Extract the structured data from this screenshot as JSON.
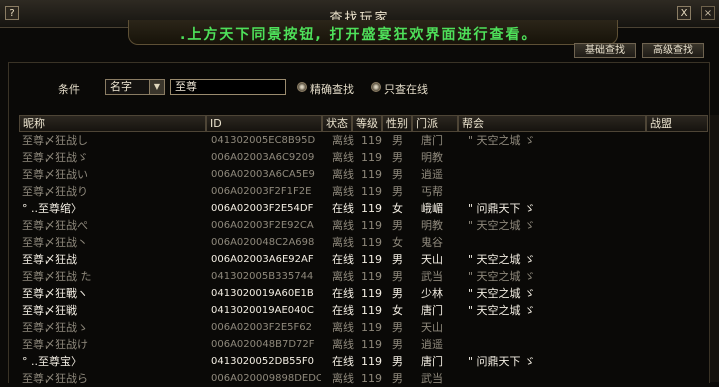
{
  "window": {
    "title": "查找玩家",
    "help": "?",
    "close": "X",
    "system_close": "×"
  },
  "banner": {
    "text": ".上方天下同景按钮, 打开盛宴狂欢界面进行查看。"
  },
  "top_buttons": {
    "basic": "基础查找",
    "advanced": "高级查找"
  },
  "search": {
    "condition_label": "条件",
    "field": "名字",
    "keyword": "至尊",
    "exact_label": "精确查找",
    "online_only_label": "只查在线"
  },
  "columns": [
    "昵称",
    "ID",
    "状态",
    "等级",
    "性别",
    "门派",
    "帮会",
    "战盟"
  ],
  "rows": [
    {
      "name": "至尊〆狂战し",
      "id": "041302005EC8B95D",
      "status": "离线",
      "level": "119",
      "gender": "男",
      "sect": "唐门",
      "guild": "\" 天空之城 ゞ",
      "alliance": "",
      "online": false
    },
    {
      "name": "至尊〆狂战ゞ",
      "id": "006A02003A6C9209",
      "status": "离线",
      "level": "119",
      "gender": "男",
      "sect": "明教",
      "guild": "",
      "alliance": "",
      "online": false
    },
    {
      "name": "至尊〆狂战い",
      "id": "006A02003A6CA5E9",
      "status": "离线",
      "level": "119",
      "gender": "男",
      "sect": "逍遥",
      "guild": "",
      "alliance": "",
      "online": false
    },
    {
      "name": "至尊〆狂战り",
      "id": "006A02003F2F1F2E",
      "status": "离线",
      "level": "119",
      "gender": "男",
      "sect": "丐帮",
      "guild": "",
      "alliance": "",
      "online": false
    },
    {
      "name": "° ..至尊绾〉",
      "id": "006A02003F2E54DF",
      "status": "在线",
      "level": "119",
      "gender": "女",
      "sect": "峨嵋",
      "guild": "\" 问鼎天下 ゞ",
      "alliance": "",
      "online": true
    },
    {
      "name": "至尊〆狂战ぺ",
      "id": "006A02003F2E92CA",
      "status": "离线",
      "level": "119",
      "gender": "男",
      "sect": "明教",
      "guild": "\" 天空之城 ゞ",
      "alliance": "",
      "online": false
    },
    {
      "name": "至尊〆狂战丶",
      "id": "006A020048C2A698",
      "status": "离线",
      "level": "119",
      "gender": "女",
      "sect": "鬼谷",
      "guild": "",
      "alliance": "",
      "online": false
    },
    {
      "name": "至尊〆狂战",
      "id": "006A02003A6E92AF",
      "status": "在线",
      "level": "119",
      "gender": "男",
      "sect": "天山",
      "guild": "\" 天空之城 ゞ",
      "alliance": "",
      "online": true
    },
    {
      "name": "至尊〆狂战 た",
      "id": "041302005B335744",
      "status": "离线",
      "level": "119",
      "gender": "男",
      "sect": "武当",
      "guild": "\" 天空之城 ゞ",
      "alliance": "",
      "online": false
    },
    {
      "name": "至尊〆狂戰ヽ",
      "id": "0413020019A60E1B",
      "status": "在线",
      "level": "119",
      "gender": "男",
      "sect": "少林",
      "guild": "\" 天空之城 ゞ",
      "alliance": "",
      "online": true
    },
    {
      "name": "至尊〆狂戦",
      "id": "0413020019AE040C",
      "status": "在线",
      "level": "119",
      "gender": "女",
      "sect": "唐门",
      "guild": "\" 天空之城 ゞ",
      "alliance": "",
      "online": true
    },
    {
      "name": "至尊〆狂战ゝ",
      "id": "006A02003F2E5F62",
      "status": "离线",
      "level": "119",
      "gender": "男",
      "sect": "天山",
      "guild": "",
      "alliance": "",
      "online": false
    },
    {
      "name": "至尊〆狂战け",
      "id": "006A020048B7D72F",
      "status": "离线",
      "level": "119",
      "gender": "男",
      "sect": "逍遥",
      "guild": "",
      "alliance": "",
      "online": false
    },
    {
      "name": "° ..至尊宝〉",
      "id": "0413020052DB55F0",
      "status": "在线",
      "level": "119",
      "gender": "男",
      "sect": "唐门",
      "guild": "\" 问鼎天下 ゞ",
      "alliance": "",
      "online": true
    },
    {
      "name": "至尊〆狂战ら",
      "id": "006A020009898DEDC",
      "status": "离线",
      "level": "119",
      "gender": "男",
      "sect": "武当",
      "guild": "",
      "alliance": "",
      "online": false
    }
  ]
}
